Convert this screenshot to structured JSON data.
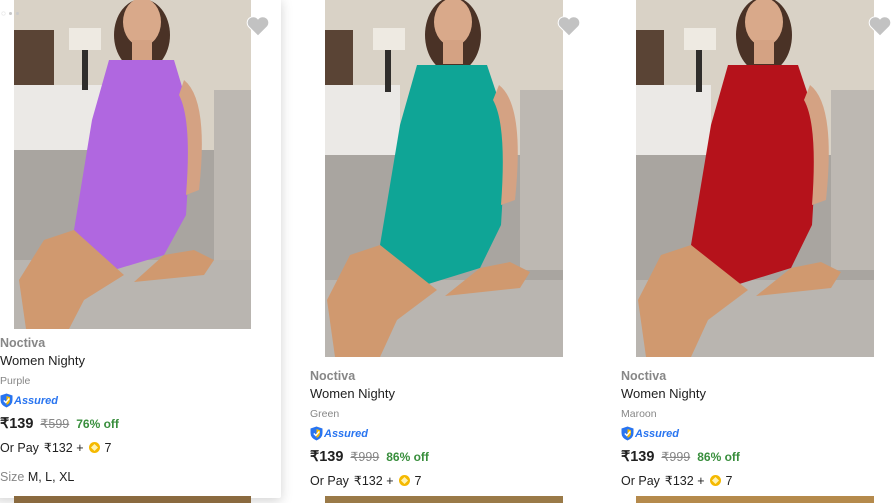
{
  "products": [
    {
      "brand": "Noctiva",
      "name": "Women Nighty",
      "color": "Purple",
      "assured": "Assured",
      "price": "₹139",
      "mrp": "₹599",
      "discount": "76% off",
      "pay_prefix": "Or Pay",
      "pay_amount": "₹132 +",
      "coins": "7",
      "size_label": "Size",
      "sizes": "M, L, XL",
      "garment_color": "#b067e0",
      "icon": "heart-icon"
    },
    {
      "brand": "Noctiva",
      "name": "Women Nighty",
      "color": "Green",
      "assured": "Assured",
      "price": "₹139",
      "mrp": "₹999",
      "discount": "86% off",
      "pay_prefix": "Or Pay",
      "pay_amount": "₹132 +",
      "coins": "7",
      "garment_color": "#0fa596",
      "icon": "heart-icon"
    },
    {
      "brand": "Noctiva",
      "name": "Women Nighty",
      "color": "Maroon",
      "assured": "Assured",
      "price": "₹139",
      "mrp": "₹999",
      "discount": "86% off",
      "pay_prefix": "Or Pay",
      "pay_amount": "₹132 +",
      "coins": "7",
      "garment_color": "#b5121b",
      "icon": "heart-icon"
    }
  ],
  "colors": {
    "discount_green": "#388e3c",
    "assured_blue": "#2874f0",
    "muted_gray": "#878787",
    "coin_gold": "#f5b900"
  }
}
